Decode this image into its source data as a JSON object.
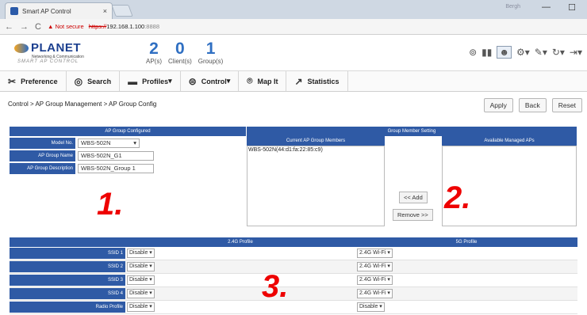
{
  "browser": {
    "tab_title": "Smart AP Control",
    "tab_close": "×",
    "win_user": "Bergh",
    "win_min": "—",
    "win_max": "☐",
    "nav_back": "←",
    "nav_forward": "→",
    "nav_reload": "C",
    "security_warning": "▲ Not secure",
    "url_scheme": "https://",
    "url_host": "192.168.1.100",
    "url_port": ":8888"
  },
  "app": {
    "logo_name": "PLANET",
    "logo_tagline": "Networking & Communication",
    "logo_subtitle": "SMART AP CONTROL",
    "counts": [
      {
        "num": "2",
        "label": "AP(s)"
      },
      {
        "num": "0",
        "label": "Client(s)"
      },
      {
        "num": "1",
        "label": "Group(s)"
      }
    ],
    "toolbar_icons": [
      "dashboard-icon",
      "chart-icon",
      "user-icon",
      "gear-icon",
      "wrench-icon",
      "refresh-icon",
      "logout-icon"
    ]
  },
  "menu": {
    "items": [
      {
        "label": "Preference",
        "icon": "tools-icon"
      },
      {
        "label": "Search",
        "icon": "search-icon"
      },
      {
        "label": "Profiles",
        "icon": "folder-icon",
        "caret": "▾"
      },
      {
        "label": "Control",
        "icon": "router-icon",
        "caret": "▾"
      },
      {
        "label": "Map It",
        "icon": "map-pin-icon"
      },
      {
        "label": "Statistics",
        "icon": "trend-icon"
      }
    ]
  },
  "page": {
    "breadcrumb": "Control > AP Group Management > AP Group Config",
    "apply_label": "Apply",
    "back_label": "Back",
    "reset_label": "Reset"
  },
  "group_config": {
    "header": "AP Group Configured",
    "model_label": "Model No.",
    "model_value": "WBS-502N",
    "name_label": "AP Group Name",
    "name_value": "WBS-502N_G1",
    "desc_label": "AP Group Description",
    "desc_value": "WBS-502N_Group 1"
  },
  "member_setting": {
    "header": "Group Member Setting",
    "current_header": "Current AP Group Members",
    "available_header": "Available Managed APs",
    "current_members": [
      "WBS-502N(44:d1:fa:22:85:c9)"
    ],
    "add_label": "<< Add",
    "remove_label": "Remove >>"
  },
  "profiles": {
    "h24": "2.4G Profile",
    "h5": "5G Profile",
    "rows": [
      {
        "label": "SSID 1",
        "v24": "Disable ▾",
        "v5": "2.4G Wi-Fi ▾"
      },
      {
        "label": "SSID 2",
        "v24": "Disable ▾",
        "v5": "2.4G Wi-Fi ▾"
      },
      {
        "label": "SSID 3",
        "v24": "Disable ▾",
        "v5": "2.4G Wi-Fi ▾"
      },
      {
        "label": "SSID 4",
        "v24": "Disable ▾",
        "v5": "2.4G Wi-Fi ▾"
      },
      {
        "label": "Radio Profile",
        "v24": "Disable ▾",
        "v5": "Disable ▾"
      }
    ]
  },
  "annotations": [
    "1.",
    "2.",
    "3."
  ]
}
